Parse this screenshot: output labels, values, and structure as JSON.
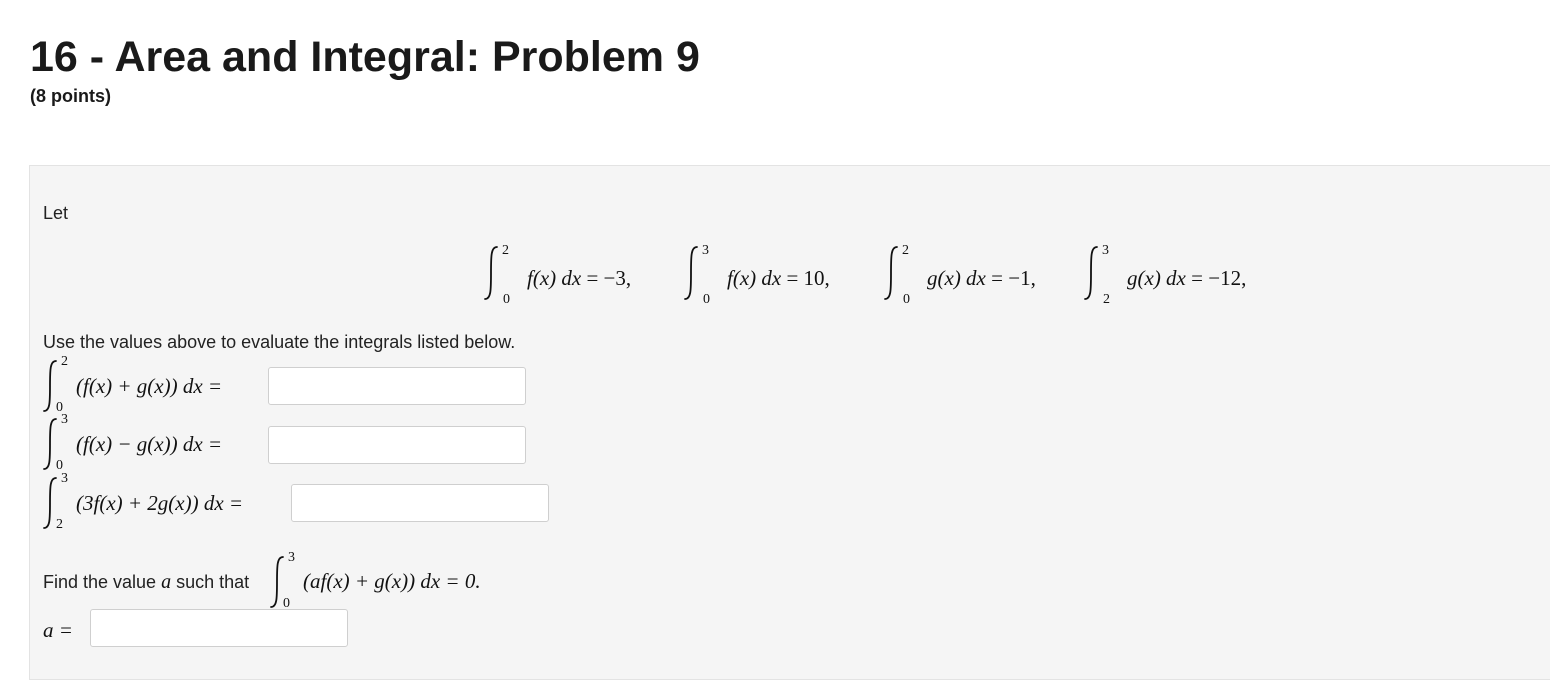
{
  "header": {
    "title": "16 - Area and Integral: Problem 9",
    "points": "(8 points)"
  },
  "problem": {
    "let_label": "Let",
    "given": [
      {
        "lower": "0",
        "upper": "2",
        "integrand": "f(x) dx",
        "result": "= −3,"
      },
      {
        "lower": "0",
        "upper": "3",
        "integrand": "f(x) dx",
        "result": "= 10,"
      },
      {
        "lower": "0",
        "upper": "2",
        "integrand": "g(x) dx",
        "result": "= −1,"
      },
      {
        "lower": "2",
        "upper": "3",
        "integrand": "g(x) dx",
        "result": "= −12,"
      }
    ],
    "instruction": "Use the values above to evaluate the integrals listed below.",
    "questions": [
      {
        "lower": "0",
        "upper": "2",
        "expr": "(f(x) + g(x)) dx =",
        "value": ""
      },
      {
        "lower": "0",
        "upper": "3",
        "expr": "(f(x) − g(x)) dx =",
        "value": ""
      },
      {
        "lower": "2",
        "upper": "3",
        "expr": "(3f(x) + 2g(x)) dx =",
        "value": ""
      }
    ],
    "find_prefix": "Find the value",
    "find_var": "a",
    "find_suffix": "such that",
    "find_integral": {
      "lower": "0",
      "upper": "3",
      "expr": "(af(x) + g(x)) dx = 0."
    },
    "a_label": "a =",
    "a_value": ""
  }
}
